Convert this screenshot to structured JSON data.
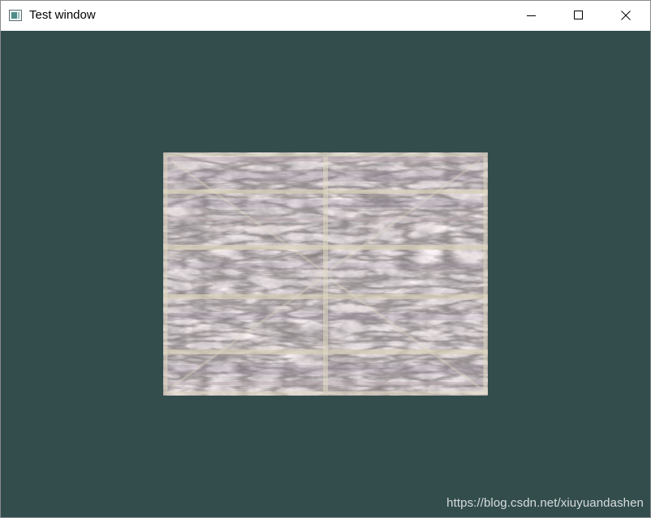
{
  "window": {
    "title": "Test window",
    "icon": "opengl-app-icon"
  },
  "titlebar_buttons": {
    "minimize": "minimize-icon",
    "maximize": "maximize-icon",
    "close": "close-icon"
  },
  "colors": {
    "clear_color": "#334d4d",
    "texture_base": "#7b7572"
  },
  "canvas": {
    "content": "textured-rectangle-with-stone-and-container-blend",
    "watermark": "https://blog.csdn.net/xiuyuandashen"
  }
}
